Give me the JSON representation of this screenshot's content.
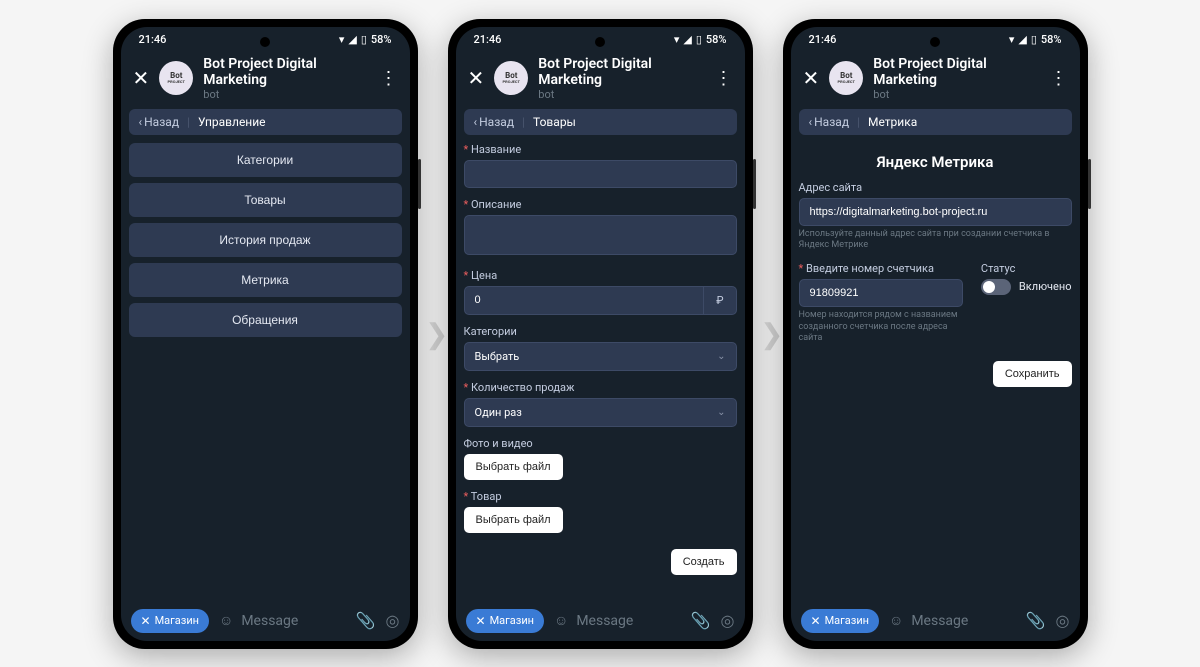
{
  "status": {
    "time": "21:46",
    "battery": "58%"
  },
  "header": {
    "name": "Bot Project Digital Marketing",
    "sub": "bot",
    "avatar_top": "Bot",
    "avatar_bottom": "PROJECT"
  },
  "chip": "Магазин",
  "message_placeholder": "Message",
  "screen1": {
    "back": "Назад",
    "crumb": "Управление",
    "menu": [
      "Категории",
      "Товары",
      "История продаж",
      "Метрика",
      "Обращения"
    ]
  },
  "screen2": {
    "back": "Назад",
    "crumb": "Товары",
    "f_name": "Название",
    "f_desc": "Описание",
    "f_price": "Цена",
    "price_val": "0",
    "currency": "₽",
    "f_cat": "Категории",
    "cat_ph": "Выбрать",
    "f_sales": "Количество продаж",
    "sales_val": "Один раз",
    "f_media": "Фото и видео",
    "file_btn": "Выбрать файл",
    "f_product": "Товар",
    "submit": "Создать"
  },
  "screen3": {
    "back": "Назад",
    "crumb": "Метрика",
    "title": "Яндекс Метрика",
    "f_url": "Адрес сайта",
    "url_val": "https://digitalmarketing.bot-project.ru",
    "url_hint": "Используйте данный адрес сайта при создании счетчика в Яндекс Метрике",
    "f_counter": "Введите номер счетчика",
    "counter_val": "91809921",
    "counter_hint": "Номер находится рядом с названием созданного счетчика после адреса сайта",
    "f_status": "Статус",
    "status_val": "Включено",
    "submit": "Сохранить"
  }
}
